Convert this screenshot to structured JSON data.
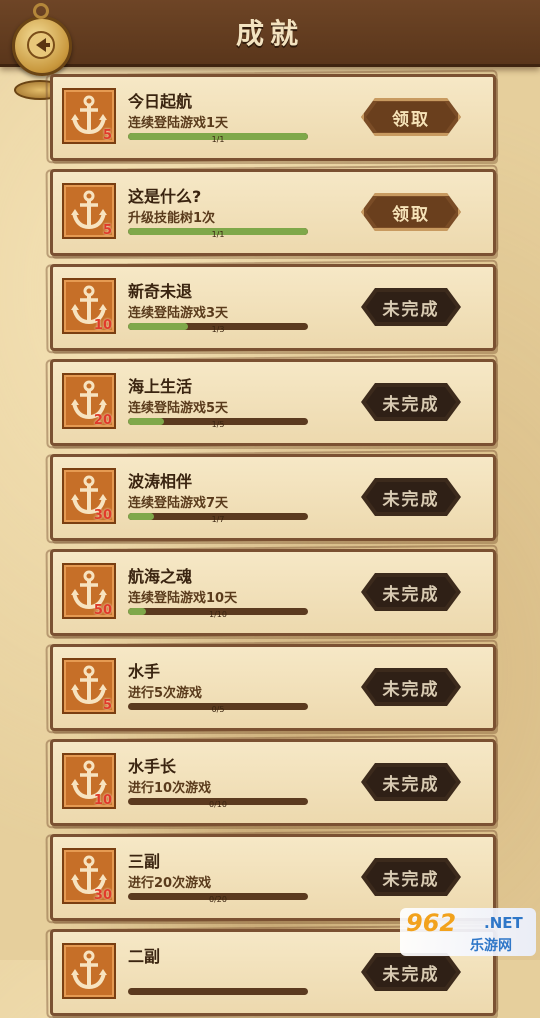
{
  "header": {
    "title": "成就"
  },
  "achievements": [
    {
      "name": "今日起航",
      "desc": "连续登陆游戏1天",
      "reward": "5",
      "progress": "1/1",
      "fraction": 1.0,
      "action": "领取",
      "status": "claim"
    },
    {
      "name": "这是什么?",
      "desc": "升级技能树1次",
      "reward": "5",
      "progress": "1/1",
      "fraction": 1.0,
      "action": "领取",
      "status": "claim"
    },
    {
      "name": "新奇未退",
      "desc": "连续登陆游戏3天",
      "reward": "10",
      "progress": "1/3",
      "fraction": 0.333,
      "action": "未完成",
      "status": "todo"
    },
    {
      "name": "海上生活",
      "desc": "连续登陆游戏5天",
      "reward": "20",
      "progress": "1/5",
      "fraction": 0.2,
      "action": "未完成",
      "status": "todo"
    },
    {
      "name": "波涛相伴",
      "desc": "连续登陆游戏7天",
      "reward": "30",
      "progress": "1/7",
      "fraction": 0.143,
      "action": "未完成",
      "status": "todo"
    },
    {
      "name": "航海之魂",
      "desc": "连续登陆游戏10天",
      "reward": "50",
      "progress": "1/10",
      "fraction": 0.1,
      "action": "未完成",
      "status": "todo"
    },
    {
      "name": "水手",
      "desc": "进行5次游戏",
      "reward": "5",
      "progress": "0/5",
      "fraction": 0,
      "action": "未完成",
      "status": "todo"
    },
    {
      "name": "水手长",
      "desc": "进行10次游戏",
      "reward": "10",
      "progress": "0/10",
      "fraction": 0,
      "action": "未完成",
      "status": "todo"
    },
    {
      "name": "三副",
      "desc": "进行20次游戏",
      "reward": "30",
      "progress": "0/20",
      "fraction": 0,
      "action": "未完成",
      "status": "todo"
    },
    {
      "name": "二副",
      "desc": "",
      "reward": "",
      "progress": "",
      "fraction": 0,
      "action": "未完成",
      "status": "todo"
    }
  ],
  "watermark": {
    "brand": "962",
    "net": ".NET",
    "site": "乐游网"
  },
  "colors": {
    "header": "#5a361b",
    "card": "#f6e8c6",
    "badge": "#c66f28",
    "progress": "#7fa84a",
    "claim": "#7a4c26",
    "todo": "#3c2a1c"
  },
  "icons": {
    "back": "back-arrow-icon",
    "badge": "anchor-icon"
  }
}
